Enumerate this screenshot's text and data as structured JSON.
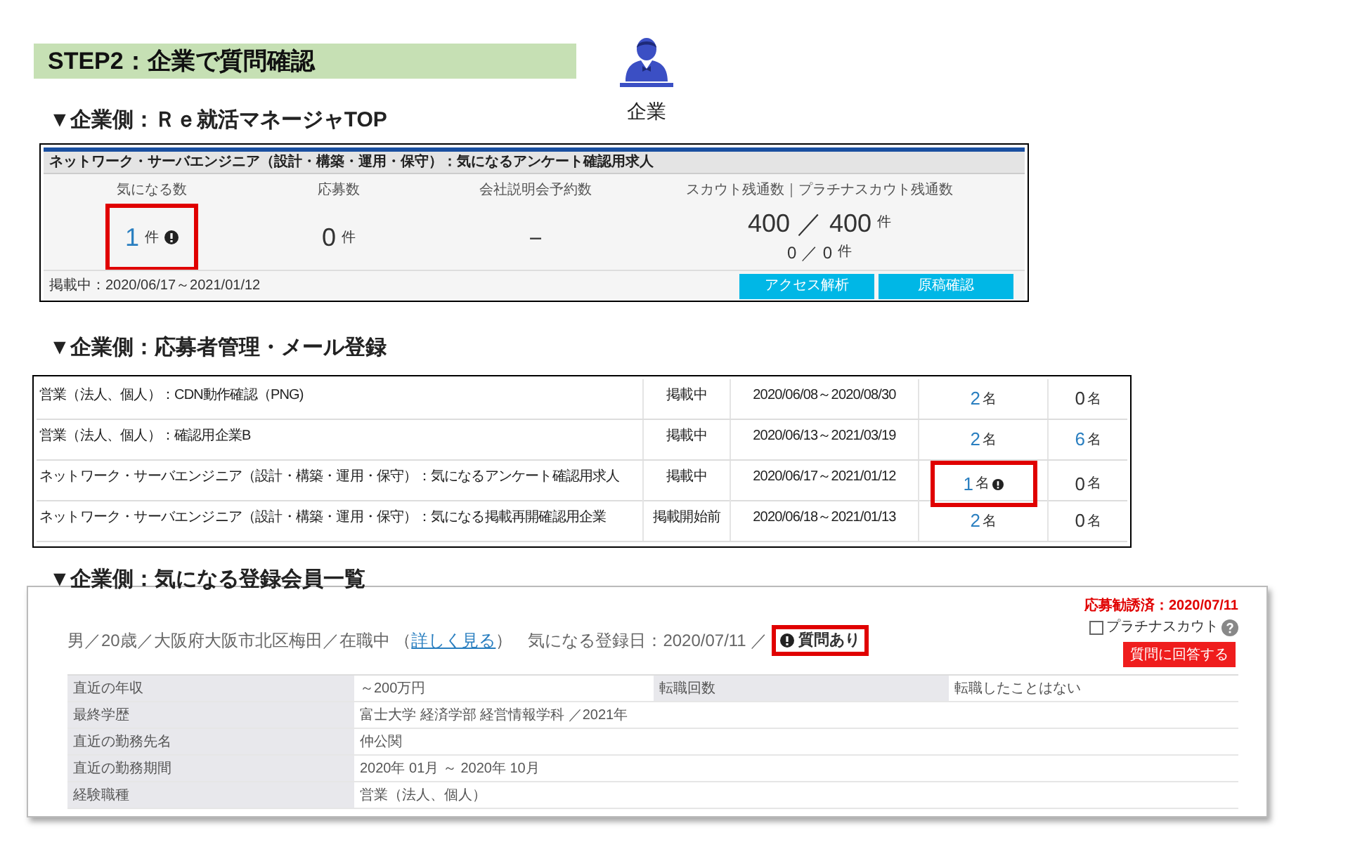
{
  "step_header": "STEP2：企業で質問確認",
  "actor": {
    "label": "企業"
  },
  "top_section": {
    "heading": "▼企業側：Ｒｅ就活マネージャTOP",
    "job_title": "ネットワーク・サーバエンジニア（設計・構築・運用・保守）：気になるアンケート確認用求人",
    "stats": [
      {
        "label": "気になる数",
        "value": "1",
        "unit": "件",
        "link": true,
        "alert": true,
        "highlighted": true
      },
      {
        "label": "応募数",
        "value": "0",
        "unit": "件",
        "link": false,
        "highlighted": false
      },
      {
        "label": "会社説明会予約数",
        "value": "－",
        "link": false,
        "highlighted": false
      },
      {
        "label": "スカウト残通数｜プラチナスカウト残通数",
        "value": "400 ／ 400",
        "unit": "件",
        "sub_value": "0 ／ 0",
        "sub_unit": "件",
        "link": false,
        "highlighted": false
      }
    ],
    "posting_period": "掲載中：2020/06/17～2021/01/12",
    "buttons": [
      "アクセス解析",
      "原稿確認"
    ]
  },
  "list_section": {
    "heading": "▼企業側：応募者管理・メール登録",
    "rows": [
      {
        "title": "営業（法人、個人）：CDN動作確認（PNG)",
        "status": "掲載中",
        "period": "2020/06/08～2020/08/30",
        "column_4": {
          "value": "2",
          "unit": "名",
          "link": true,
          "alert": false,
          "highlighted": false
        },
        "column_5": {
          "value": "0",
          "unit": "名",
          "link": false
        }
      },
      {
        "title": "営業（法人、個人）：確認用企業B",
        "status": "掲載中",
        "period": "2020/06/13～2021/03/19",
        "column_4": {
          "value": "2",
          "unit": "名",
          "link": true,
          "alert": false,
          "highlighted": false
        },
        "column_5": {
          "value": "6",
          "unit": "名",
          "link": true
        }
      },
      {
        "title": "ネットワーク・サーバエンジニア（設計・構築・運用・保守）：気になるアンケート確認用求人",
        "status": "掲載中",
        "period": "2020/06/17～2021/01/12",
        "column_4": {
          "value": "1",
          "unit": "名",
          "link": true,
          "alert": true,
          "highlighted": true
        },
        "column_5": {
          "value": "0",
          "unit": "名",
          "link": false
        }
      },
      {
        "title": "ネットワーク・サーバエンジニア（設計・構築・運用・保守）：気になる掲載再開確認用企業",
        "status": "掲載開始前",
        "period": "2020/06/18～2021/01/13",
        "column_4": {
          "value": "2",
          "unit": "名",
          "link": true,
          "alert": false,
          "highlighted": false
        },
        "column_5": {
          "value": "0",
          "unit": "名",
          "link": false
        }
      }
    ]
  },
  "member_section": {
    "heading": "▼企業側：気になる登録会員一覧",
    "summary_before": "男／20歳／大阪府大阪市北区梅田／在職中 （",
    "detail_link": "詳しく見る",
    "summary_after": "）",
    "registered": "気になる登録日：2020/07/11 ／",
    "question_badge": {
      "label": "質問あり",
      "highlighted": true
    },
    "invited": "応募勧誘済：2020/07/11",
    "platinum_scout": {
      "label": "プラチナスカウト",
      "checked": false
    },
    "answer_button": "質問に回答する",
    "details": [
      {
        "label": "直近の年収",
        "value": "～200万円",
        "label_2": "転職回数",
        "value_2": "転職したことはない"
      },
      {
        "label": "最終学歴",
        "value": "富士大学 経済学部 経営情報学科 ／2021年"
      },
      {
        "label": "直近の勤務先名",
        "value": "仲公関"
      },
      {
        "label": "直近の勤務期間",
        "value": "2020年 01月 ～ 2020年 10月"
      },
      {
        "label": "経験職種",
        "value": "営業（法人、個人）"
      }
    ]
  }
}
